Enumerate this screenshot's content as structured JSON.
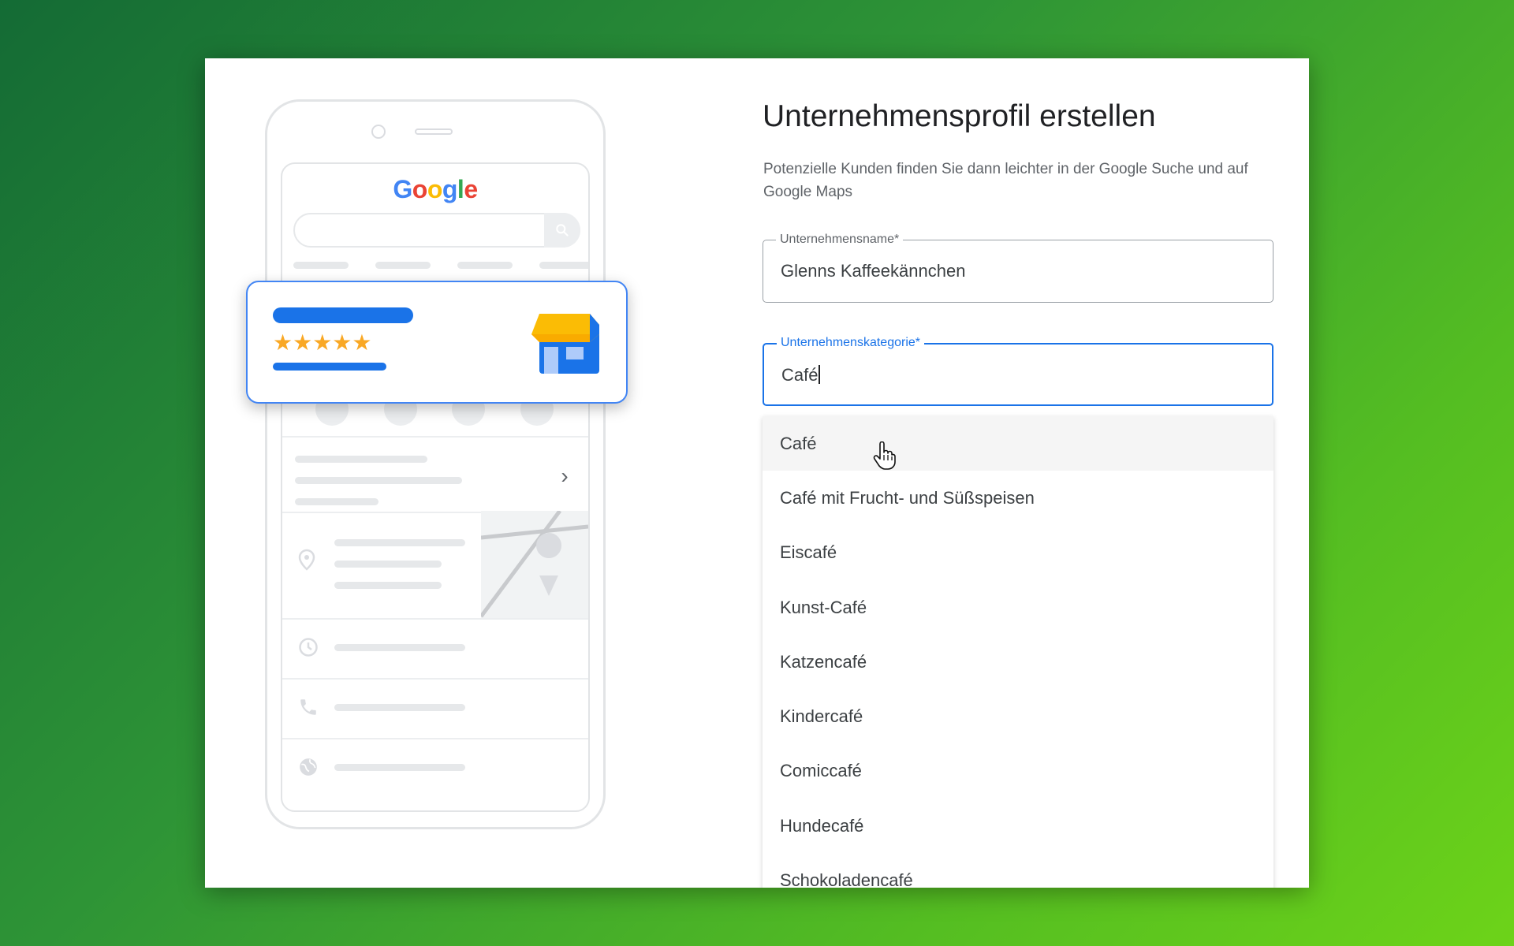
{
  "illustration": {
    "logo_letters": [
      "G",
      "o",
      "o",
      "g",
      "l",
      "e"
    ],
    "stars": "★★★★★",
    "chevron": "›",
    "icons": [
      "phone-icon",
      "directions-icon",
      "bookmark-icon",
      "globe-icon",
      "location-pin-icon",
      "clock-icon",
      "search-icon",
      "store-icon"
    ]
  },
  "form": {
    "title": "Unternehmensprofil erstellen",
    "subtitle": "Potenzielle Kunden finden Sie dann leichter in der Google Suche und auf Google Maps",
    "name_field": {
      "label": "Unternehmensname*",
      "value": "Glenns Kaffeekännchen"
    },
    "category_field": {
      "label": "Unternehmenskategorie*",
      "value": "Café"
    },
    "suggestions": [
      "Café",
      "Café mit Frucht- und Süßspeisen",
      "Eiscafé",
      "Kunst-Café",
      "Katzencafé",
      "Kindercafé",
      "Comiccafé",
      "Hundecafé",
      "Schokoladencafé"
    ]
  },
  "colors": {
    "accent": "#1a73e8",
    "star": "#f9a825",
    "store_awning": "#fbbc05"
  }
}
